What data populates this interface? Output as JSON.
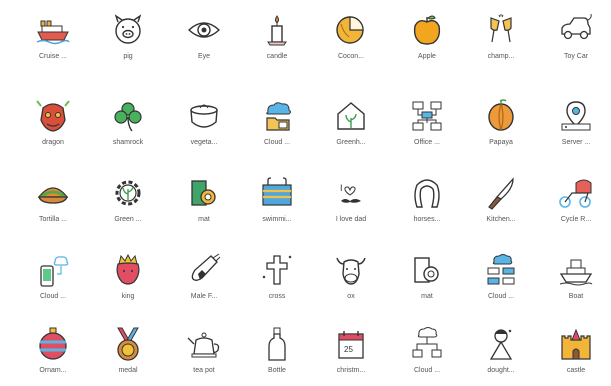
{
  "icons": [
    {
      "label": "Cruise ...",
      "icon": "cruise-ship-icon"
    },
    {
      "label": "pig",
      "icon": "pig-icon"
    },
    {
      "label": "Eye",
      "icon": "eye-icon"
    },
    {
      "label": "candle",
      "icon": "candle-icon"
    },
    {
      "label": "Cocon...",
      "icon": "coconut-icon"
    },
    {
      "label": "Apple",
      "icon": "apple-icon"
    },
    {
      "label": "champ...",
      "icon": "champagne-icon"
    },
    {
      "label": "Toy Car",
      "icon": "toy-car-icon"
    },
    {
      "label": "dragon",
      "icon": "dragon-icon"
    },
    {
      "label": "shamrock",
      "icon": "shamrock-icon"
    },
    {
      "label": "vegeta...",
      "icon": "vegetable-pot-icon"
    },
    {
      "label": "Cloud ...",
      "icon": "cloud-folder-icon"
    },
    {
      "label": "Greenh...",
      "icon": "greenhouse-icon"
    },
    {
      "label": "Office ...",
      "icon": "office-network-icon"
    },
    {
      "label": "Papaya",
      "icon": "papaya-icon"
    },
    {
      "label": "Server ...",
      "icon": "server-location-icon"
    },
    {
      "label": "Tortilla ...",
      "icon": "tortilla-icon"
    },
    {
      "label": "Green ...",
      "icon": "green-gear-icon"
    },
    {
      "label": "mat",
      "icon": "mat-roll-icon"
    },
    {
      "label": "swimmi...",
      "icon": "swimming-pool-icon"
    },
    {
      "label": "I love dad",
      "icon": "love-dad-icon"
    },
    {
      "label": "horses...",
      "icon": "horseshoe-icon"
    },
    {
      "label": "Kitchen...",
      "icon": "kitchen-knife-icon"
    },
    {
      "label": "Cycle R...",
      "icon": "cycle-rickshaw-icon"
    },
    {
      "label": "Cloud ...",
      "icon": "cloud-phone-icon"
    },
    {
      "label": "king",
      "icon": "king-icon"
    },
    {
      "label": "Male F...",
      "icon": "male-flask-icon"
    },
    {
      "label": "cross",
      "icon": "cross-icon"
    },
    {
      "label": "ox",
      "icon": "ox-icon"
    },
    {
      "label": "mat",
      "icon": "mat-outline-icon"
    },
    {
      "label": "Cloud ...",
      "icon": "cloud-network-icon"
    },
    {
      "label": "Boat",
      "icon": "boat-icon"
    },
    {
      "label": "Ornam...",
      "icon": "ornament-icon"
    },
    {
      "label": "medal",
      "icon": "medal-icon"
    },
    {
      "label": "tea pot",
      "icon": "tea-pot-icon"
    },
    {
      "label": "Bottle",
      "icon": "bottle-icon"
    },
    {
      "label": "christm...",
      "icon": "christmas-calendar-icon"
    },
    {
      "label": "Cloud ...",
      "icon": "cloud-tree-icon"
    },
    {
      "label": "dought...",
      "icon": "daughter-icon"
    },
    {
      "label": "castle",
      "icon": "castle-icon"
    }
  ]
}
